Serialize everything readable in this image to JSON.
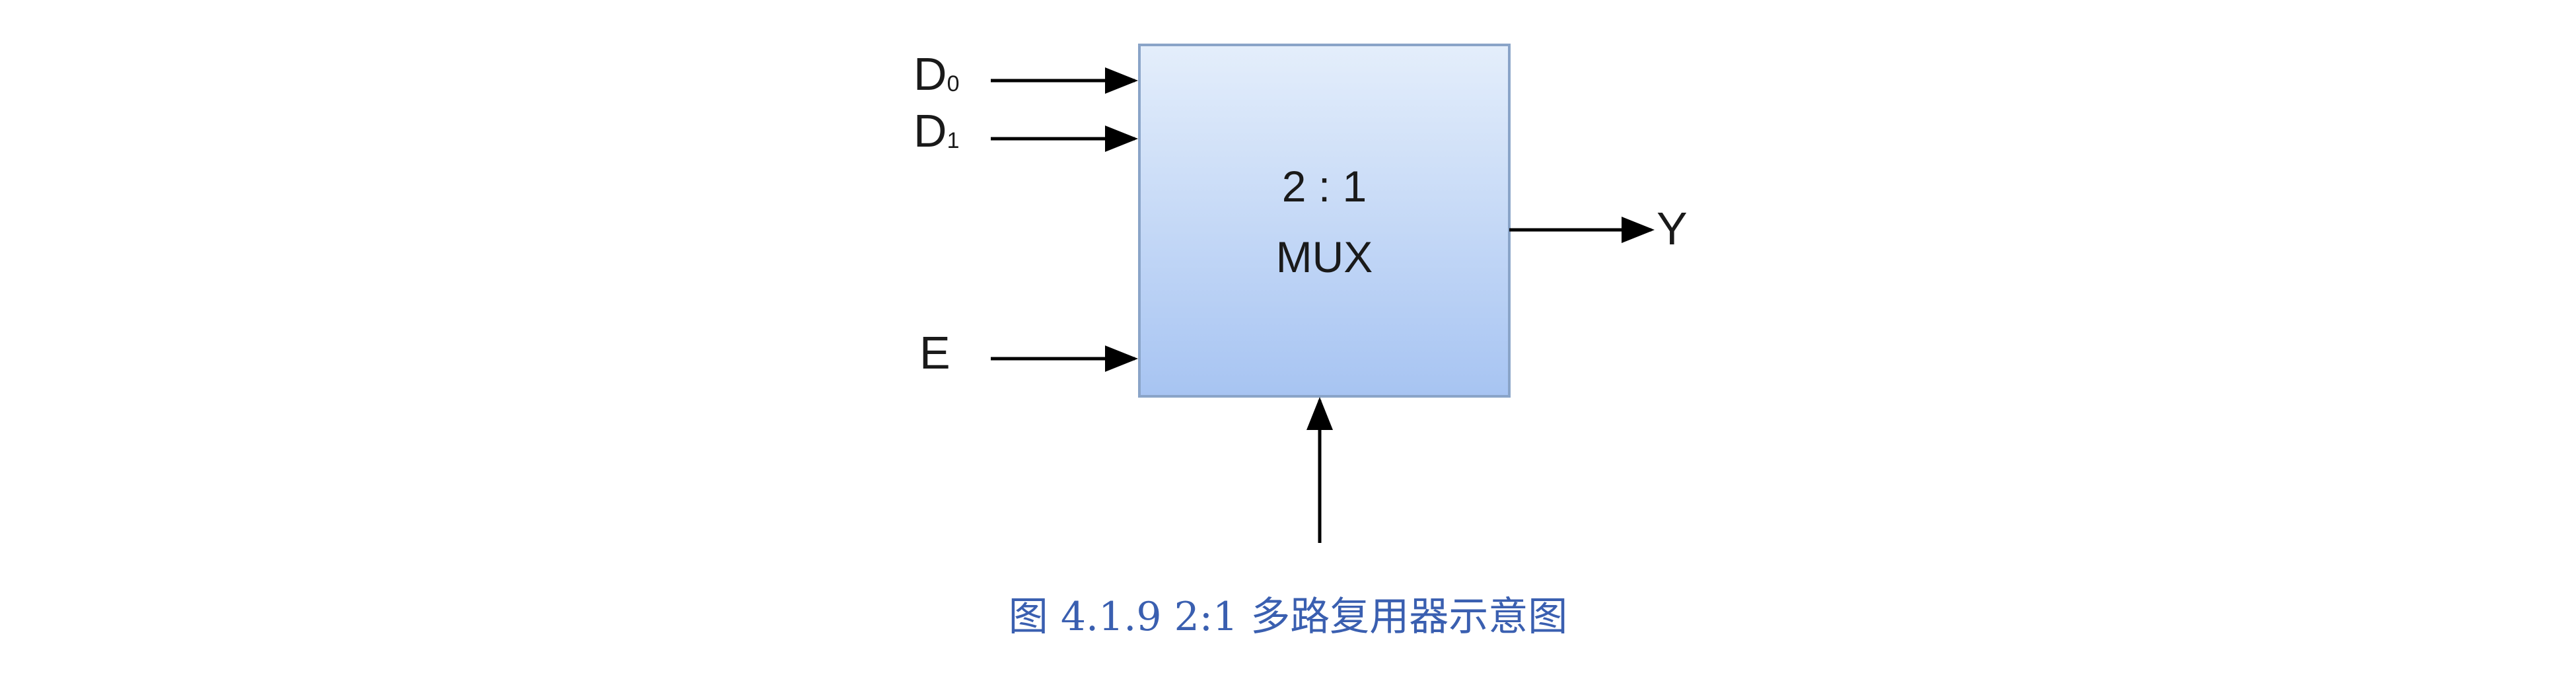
{
  "diagram": {
    "block": {
      "line1": "2 : 1",
      "line2": "MUX",
      "gradient_top": "#e4eefb",
      "gradient_bottom": "#a7c4f2",
      "border_color": "#8aa4c8"
    },
    "inputs": {
      "d0": {
        "letter": "D",
        "sub": "0"
      },
      "d1": {
        "letter": "D",
        "sub": "1"
      },
      "enable": "E"
    },
    "output": "Y"
  },
  "caption": "图 4.1.9 2:1 多路复用器示意图",
  "colors": {
    "caption": "#3a5fb0",
    "wire": "#000000"
  }
}
